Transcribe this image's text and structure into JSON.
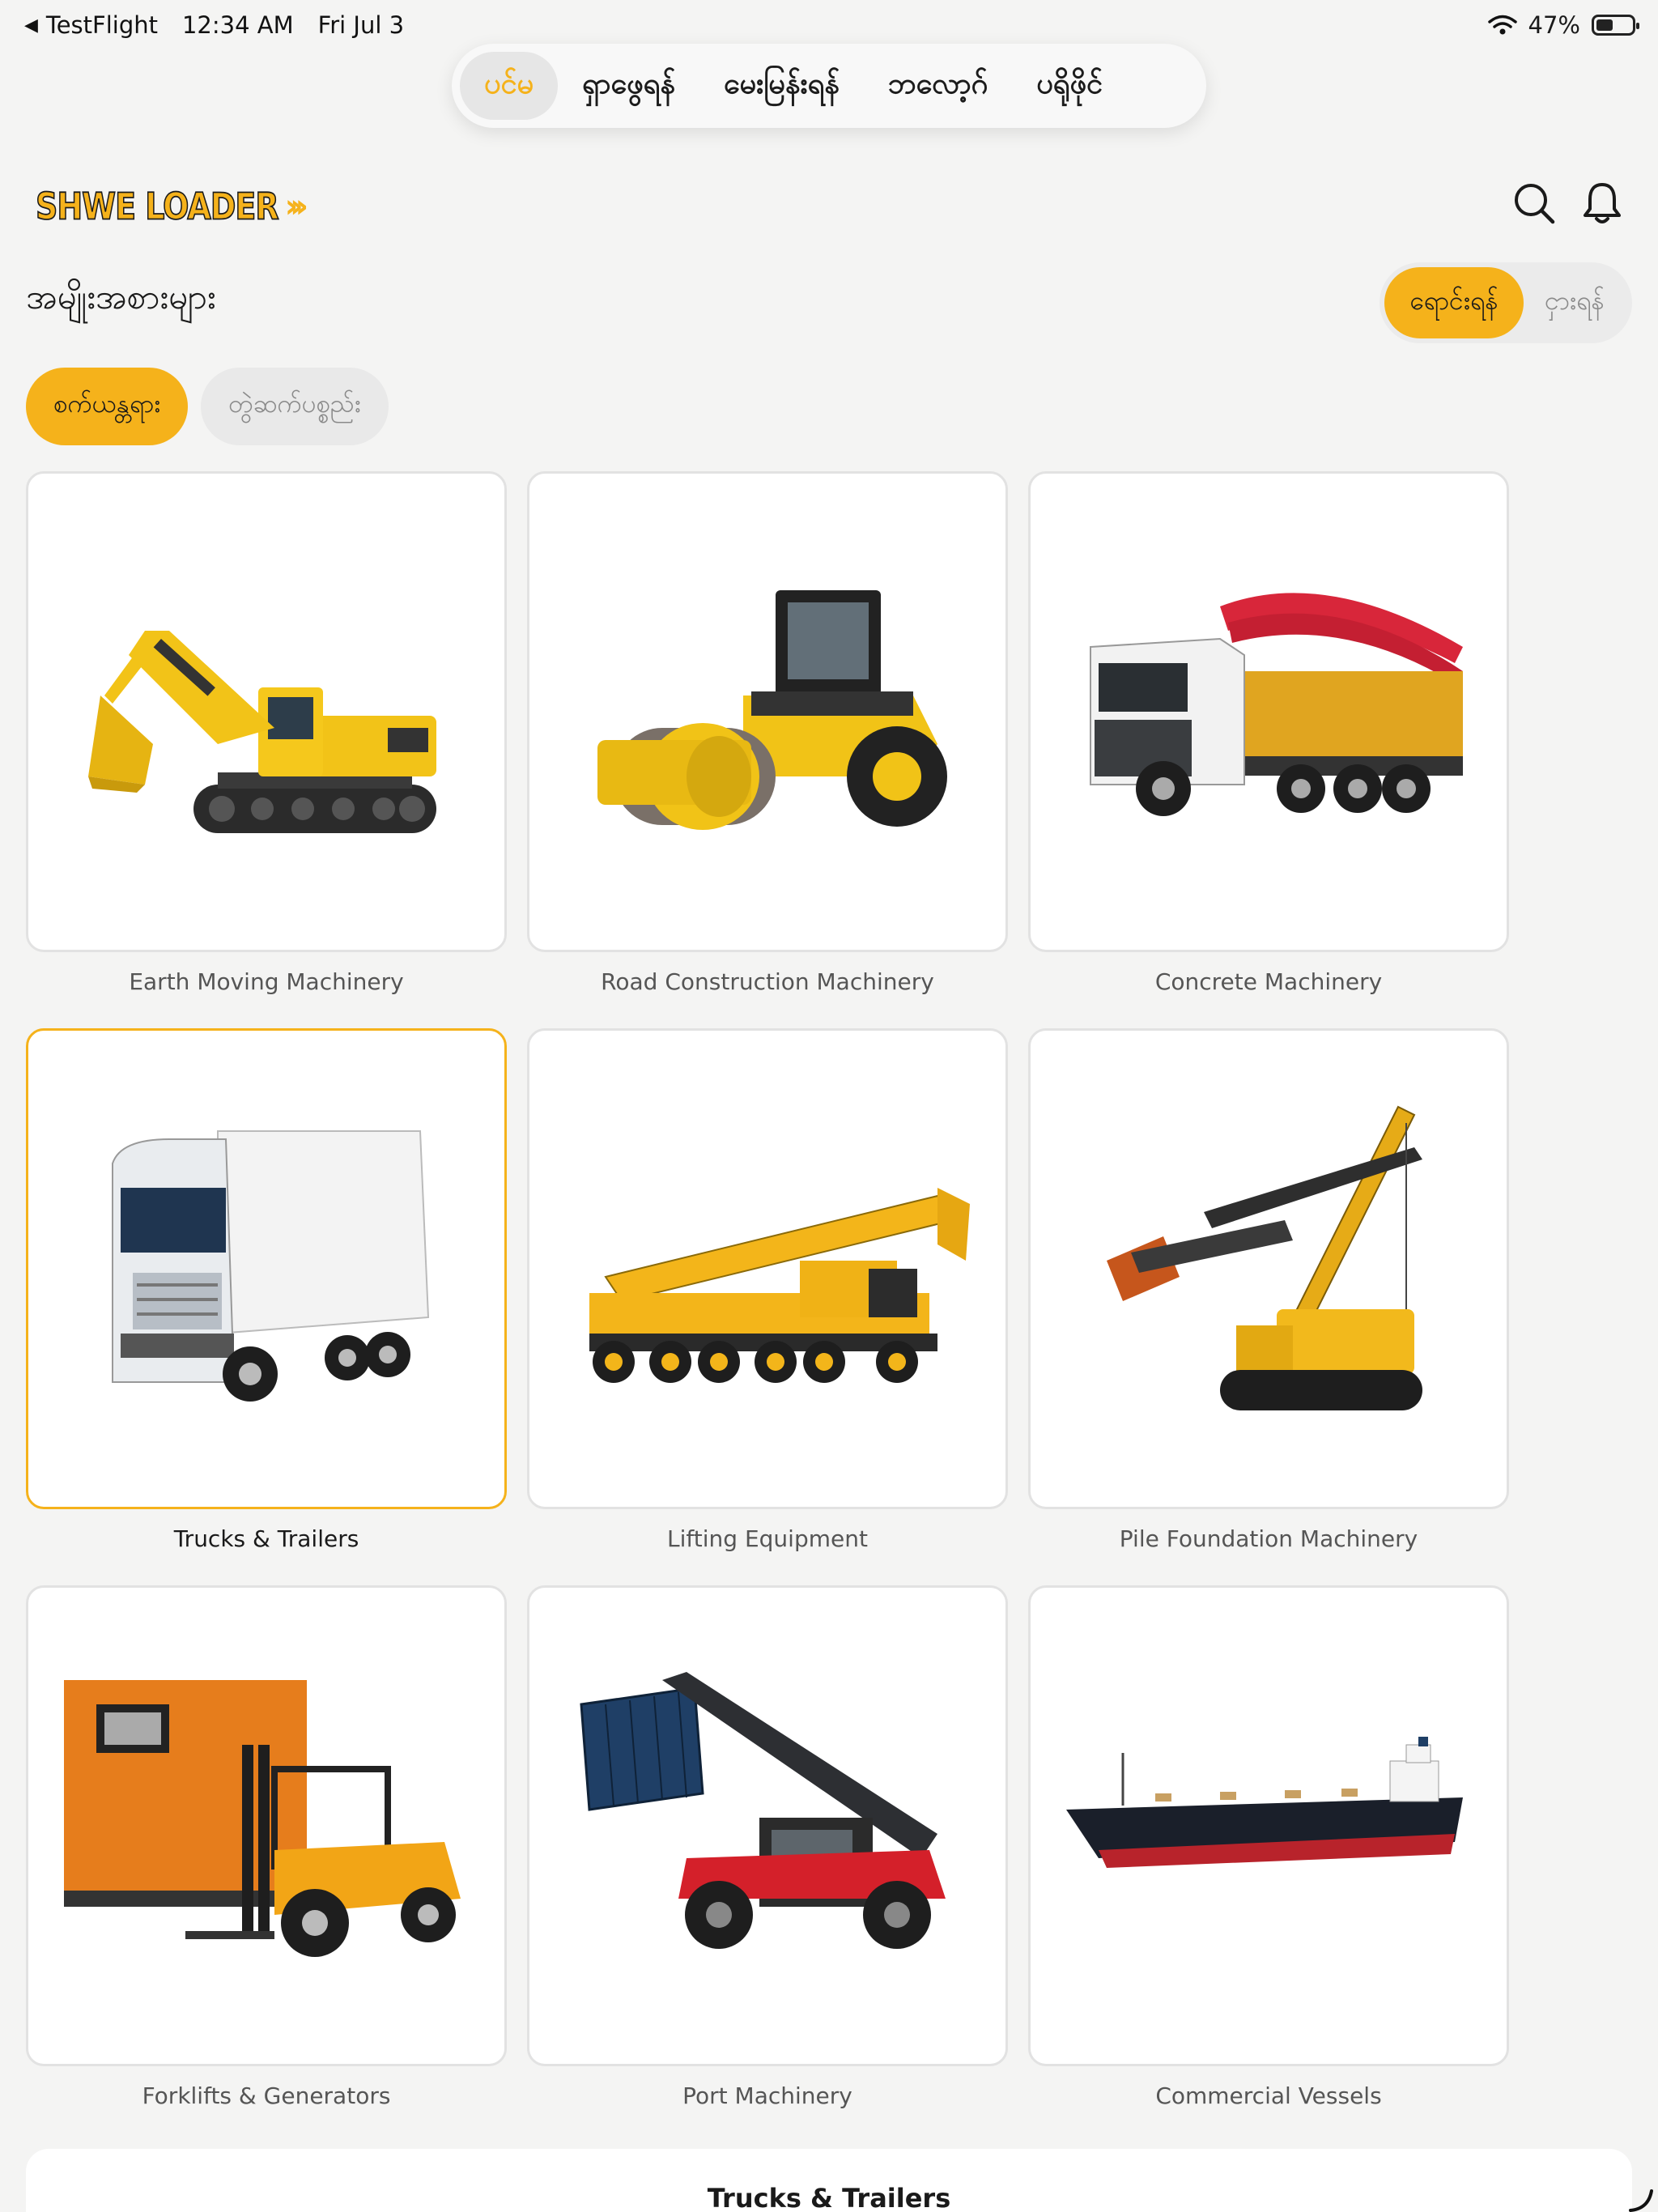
{
  "status_bar": {
    "back_app": "TestFlight",
    "time": "12:34 AM",
    "date": "Fri Jul 3",
    "battery": "47%"
  },
  "top_tabs": [
    {
      "label": "ပင်မ",
      "active": true
    },
    {
      "label": "ရှာဖွေရန်",
      "active": false
    },
    {
      "label": "မေးမြန်းရန်",
      "active": false
    },
    {
      "label": "ဘလော့ဂ်",
      "active": false
    },
    {
      "label": "ပရိုဖိုင်",
      "active": false
    }
  ],
  "header": {
    "logo_text": "SHWE LOADER",
    "logo_arrows": "›››"
  },
  "section_title": "အမျိုးအစားများ",
  "toggle": {
    "sell_label": "ရောင်းရန်",
    "rent_label": "ငှားရန်"
  },
  "chips": {
    "machinery": "စက်ယန္တရား",
    "attachments": "တွဲဆက်ပစ္စည်း"
  },
  "categories": [
    {
      "label": "Earth Moving Machinery",
      "icon": "excavator-icon"
    },
    {
      "label": "Road Construction Machinery",
      "icon": "road-roller-icon"
    },
    {
      "label": "Concrete Machinery",
      "icon": "concrete-pump-truck-icon"
    },
    {
      "label": "Trucks & Trailers",
      "icon": "truck-trailer-icon",
      "selected": true
    },
    {
      "label": "Lifting Equipment",
      "icon": "mobile-crane-icon"
    },
    {
      "label": "Pile Foundation Machinery",
      "icon": "pile-rig-icon"
    },
    {
      "label": "Forklifts & Generators",
      "icon": "forklift-generator-icon"
    },
    {
      "label": "Port Machinery",
      "icon": "reach-stacker-icon"
    },
    {
      "label": "Commercial Vessels",
      "icon": "cargo-ship-icon"
    }
  ],
  "bottom_sheet": {
    "title": "Trucks & Trailers"
  },
  "colors": {
    "accent": "#f5b21b",
    "background": "#f4f4f3"
  }
}
